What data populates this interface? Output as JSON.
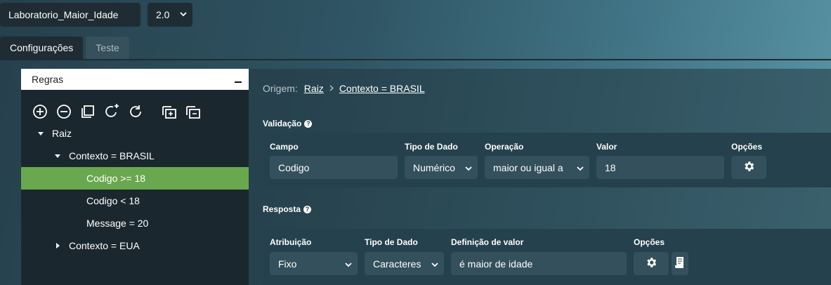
{
  "topbar": {
    "project": "Laboratorio_Maior_Idade",
    "version": "2.0"
  },
  "tabs": [
    {
      "label": "Configurações",
      "active": true
    },
    {
      "label": "Teste",
      "active": false
    }
  ],
  "rules": {
    "title": "Regras",
    "toolbar_icons": [
      "add-circle-icon",
      "remove-circle-icon",
      "copy-icon",
      "add-rotate-icon",
      "refresh-icon",
      "add-layers-icon",
      "remove-layers-icon"
    ],
    "tree": [
      {
        "label": "Raiz"
      },
      {
        "label": "Contexto = BRASIL"
      },
      {
        "label": "Codigo >= 18"
      },
      {
        "label": "Codigo < 18"
      },
      {
        "label": "Message = 20"
      },
      {
        "label": "Contexto = EUA"
      }
    ]
  },
  "breadcrumb": {
    "prefix": "Origem:",
    "root": "Raiz",
    "current": "Contexto = BRASIL"
  },
  "validacao": {
    "title": "Validação",
    "labels": {
      "campo": "Campo",
      "tipo": "Tipo de Dado",
      "operacao": "Operação",
      "valor": "Valor",
      "opcoes": "Opções"
    },
    "values": {
      "campo": "Codigo",
      "tipo": "Numérico",
      "operacao": "maior ou igual a",
      "valor": "18"
    }
  },
  "resposta": {
    "title": "Resposta",
    "labels": {
      "atribuicao": "Atribuição",
      "tipo": "Tipo de Dado",
      "definicao": "Definição de valor",
      "opcoes": "Opções"
    },
    "values": {
      "atribuicao": "Fixo",
      "tipo": "Caracteres",
      "definicao": "é maior de idade"
    }
  },
  "colors": {
    "selected_row": "#6aa84f",
    "panel_bg": "#1b272e"
  }
}
